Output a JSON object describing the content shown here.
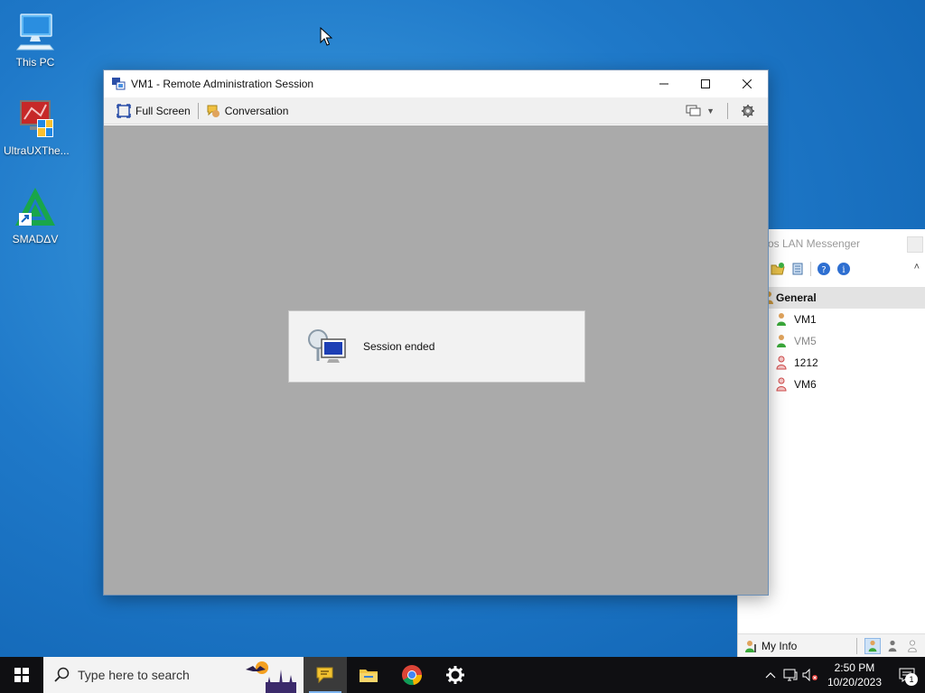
{
  "desktop": {
    "icons": [
      {
        "label": "This PC"
      },
      {
        "label": "UltraUXThe..."
      },
      {
        "label": "SMADΔV"
      }
    ]
  },
  "window": {
    "title": "VM1 - Remote Administration Session",
    "toolbar": {
      "full_screen": "Full Screen",
      "conversation": "Conversation"
    },
    "dialog": {
      "message": "Session ended"
    }
  },
  "lan_messenger": {
    "title": "os LAN Messenger",
    "group": "General",
    "users": [
      {
        "name": "VM1",
        "status": "online"
      },
      {
        "name": "VM5",
        "status": "offline"
      },
      {
        "name": "1212",
        "status": "busy"
      },
      {
        "name": "VM6",
        "status": "busy"
      }
    ],
    "my_info": "My Info"
  },
  "taskbar": {
    "search_placeholder": "Type here to search",
    "time": "2:50 PM",
    "date": "10/20/2023",
    "notification_count": "1"
  },
  "colors": {
    "desktop": "#1f79c9",
    "content_bg": "#aaaaaa",
    "taskbar": "#0f0f12"
  }
}
